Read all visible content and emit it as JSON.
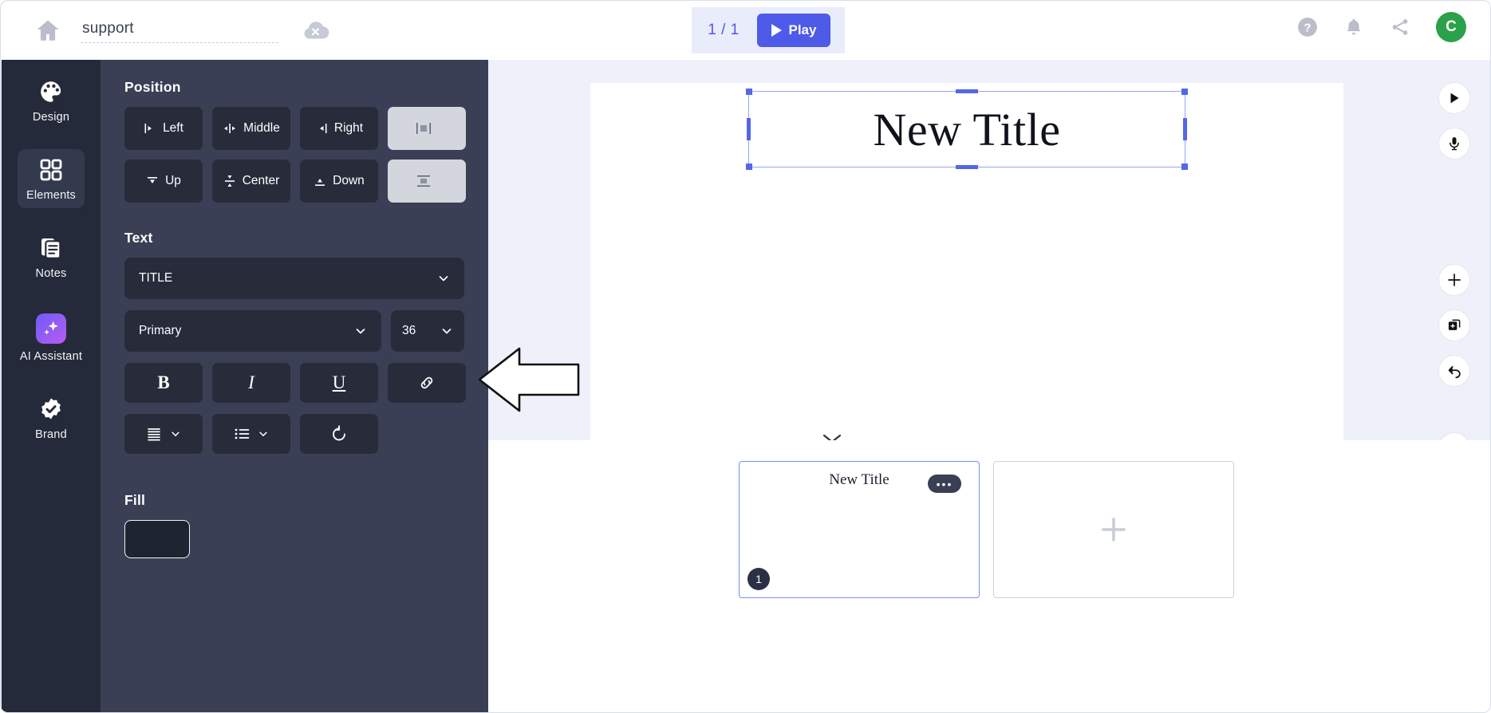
{
  "topbar": {
    "home_icon": "home-icon",
    "deck_title": "support",
    "deck_title_placeholder": "Untitled",
    "cloud_icon": "cloud-offline-icon",
    "page_indicator": "1 / 1",
    "play_label": "Play",
    "help_icon": "help-circle-icon",
    "notifications_icon": "bell-icon",
    "share_icon": "share-icon",
    "avatar_initial": "C"
  },
  "rail": {
    "items": [
      {
        "label": "Design",
        "icon": "palette-icon",
        "active": false
      },
      {
        "label": "Elements",
        "icon": "grid-icon",
        "active": true
      },
      {
        "label": "Notes",
        "icon": "notes-icon",
        "active": false
      },
      {
        "label": "AI Assistant",
        "icon": "sparkles-icon",
        "active": false
      },
      {
        "label": "Brand",
        "icon": "badge-check-icon",
        "active": false
      }
    ]
  },
  "panel": {
    "position": {
      "title": "Position",
      "buttons": [
        {
          "label": "Left",
          "icon": "align-left-icon",
          "style": "dark"
        },
        {
          "label": "Middle",
          "icon": "align-center-h-icon",
          "style": "dark"
        },
        {
          "label": "Right",
          "icon": "align-right-icon",
          "style": "dark"
        },
        {
          "label": "",
          "icon": "distribute-h-icon",
          "style": "light"
        },
        {
          "label": "Up",
          "icon": "align-top-icon",
          "style": "dark"
        },
        {
          "label": "Center",
          "icon": "align-center-v-icon",
          "style": "dark"
        },
        {
          "label": "Down",
          "icon": "align-bottom-icon",
          "style": "dark"
        },
        {
          "label": "",
          "icon": "distribute-v-icon",
          "style": "light"
        }
      ]
    },
    "text": {
      "title": "Text",
      "style_value": "TITLE",
      "color_value": "Primary",
      "size_value": "36",
      "bold_label": "B",
      "italic_label": "I",
      "underline_label": "U",
      "link_icon": "link-icon",
      "align_icon": "text-align-icon",
      "list_icon": "bullet-list-icon",
      "reset_icon": "reset-icon"
    },
    "fill": {
      "title": "Fill",
      "swatch_color": "#1e2430"
    }
  },
  "canvas": {
    "title_text": "New Title",
    "right_tools": [
      {
        "icon": "play-icon",
        "name": "preview-button"
      },
      {
        "icon": "microphone-icon",
        "name": "record-button"
      },
      {
        "icon": "plus-icon",
        "name": "add-slide-button"
      },
      {
        "icon": "duplicate-icon",
        "name": "duplicate-slide-button"
      },
      {
        "icon": "undo-icon",
        "name": "undo-button"
      },
      {
        "icon": "trash-icon",
        "name": "delete-button"
      }
    ],
    "collapse_icon": "chevron-down-icon"
  },
  "filmstrip": {
    "slides": [
      {
        "title": "New Title",
        "number": "1",
        "selected": true,
        "menu": "•••"
      }
    ],
    "add_label": "+"
  },
  "annotation": {
    "arrow": "pointer-arrow-left",
    "target": "link-button"
  },
  "colors": {
    "accent": "#4e5ae8",
    "panel_bg": "#3a3f55",
    "rail_bg": "#252a3a",
    "stage_bg": "#eef1fa",
    "avatar_bg": "#2aa14a"
  }
}
